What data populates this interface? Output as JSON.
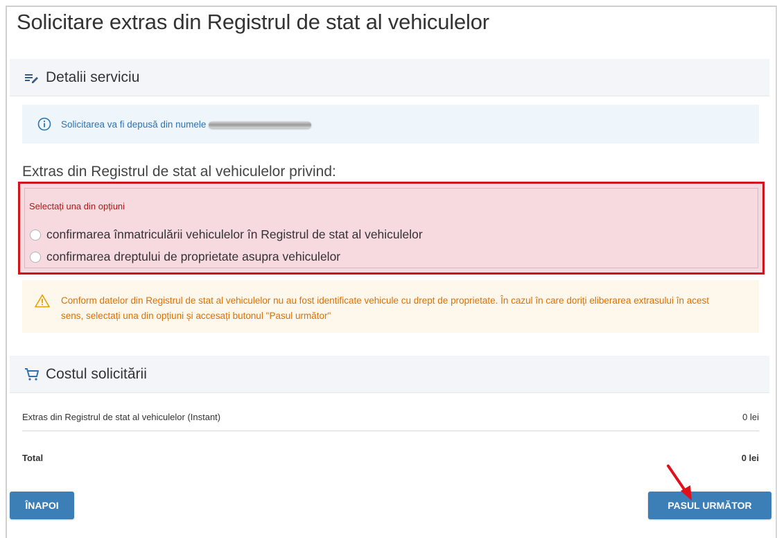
{
  "page": {
    "title": "Solicitare extras din Registrul de stat al vehiculelor"
  },
  "service_details": {
    "header": "Detalii serviciu",
    "info_text": "Solicitarea va fi depusă din numele",
    "subtitle": "Extras din Registrul de stat al vehiculelor privind:",
    "options_hint": "Selectați una din opțiuni",
    "options": [
      {
        "label": "confirmarea înmatriculării vehiculelor în Registrul de stat al vehiculelor",
        "selected": false
      },
      {
        "label": "confirmarea dreptului de proprietate asupra vehiculelor",
        "selected": false
      }
    ],
    "warning_text": "Conform datelor din Registrul de stat al vehiculelor nu au fost identificate vehicule cu drept de proprietate. În cazul în care doriți eliberarea extrasului în acest sens, selectați una din opțiuni și accesați butonul \"Pasul următor\""
  },
  "cost": {
    "header": "Costul solicitării",
    "item_label": "Extras din Registrul de stat al vehiculelor (Instant)",
    "item_value": "0 lei",
    "total_label": "Total",
    "total_value": "0 lei"
  },
  "buttons": {
    "back_label": "ÎNAPOI",
    "next_label": "PASUL URMĂTOR"
  },
  "icons": {
    "details": "list-edit-icon",
    "info": "info-icon",
    "warning": "warning-icon",
    "cart": "cart-icon",
    "annotation": "red-arrow-icon"
  },
  "colors": {
    "primary_button": "#3c7fb6",
    "info_text": "#2a73b8",
    "warning_text": "#e07000",
    "highlight_border": "#d0141c",
    "highlight_fill": "#f6dadf"
  }
}
